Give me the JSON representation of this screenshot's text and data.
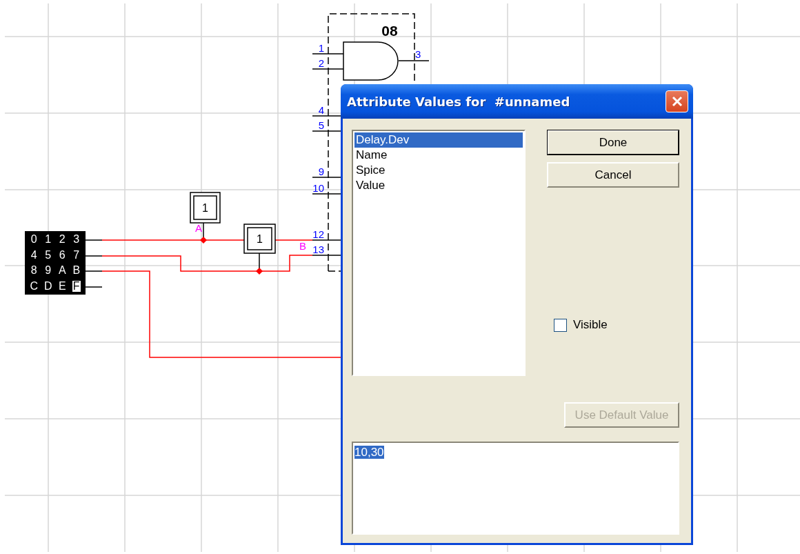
{
  "schematic": {
    "chip": {
      "label": "08",
      "output_pin": "3",
      "input_pins": [
        "1",
        "2",
        "4",
        "5",
        "9",
        "10",
        "12",
        "13"
      ]
    },
    "probes": [
      {
        "value": "1",
        "label": "A"
      },
      {
        "value": "1",
        "label": "B"
      }
    ],
    "keypad": [
      {
        "label": "0",
        "pressed": false
      },
      {
        "label": "1",
        "pressed": false
      },
      {
        "label": "2",
        "pressed": false
      },
      {
        "label": "3",
        "pressed": false
      },
      {
        "label": "4",
        "pressed": false
      },
      {
        "label": "5",
        "pressed": false
      },
      {
        "label": "6",
        "pressed": false
      },
      {
        "label": "7",
        "pressed": false
      },
      {
        "label": "8",
        "pressed": false
      },
      {
        "label": "9",
        "pressed": false
      },
      {
        "label": "A",
        "pressed": false
      },
      {
        "label": "B",
        "pressed": false
      },
      {
        "label": "C",
        "pressed": false
      },
      {
        "label": "D",
        "pressed": false
      },
      {
        "label": "E",
        "pressed": false
      },
      {
        "label": "F",
        "pressed": true
      }
    ]
  },
  "dialog": {
    "title": "Attribute Values for  #unnamed",
    "attributes": [
      {
        "name": "Delay.Dev",
        "selected": true
      },
      {
        "name": "Name",
        "selected": false
      },
      {
        "name": "Spice",
        "selected": false
      },
      {
        "name": "Value",
        "selected": false
      }
    ],
    "buttons": [
      {
        "label": "Done",
        "default": true
      },
      {
        "label": "Cancel",
        "default": false
      }
    ],
    "visible": {
      "label": "Visible",
      "checked": false
    },
    "default_value_button": {
      "label": "Use Default Value",
      "disabled": true
    },
    "value": {
      "text": "10,30",
      "selected": true
    }
  }
}
